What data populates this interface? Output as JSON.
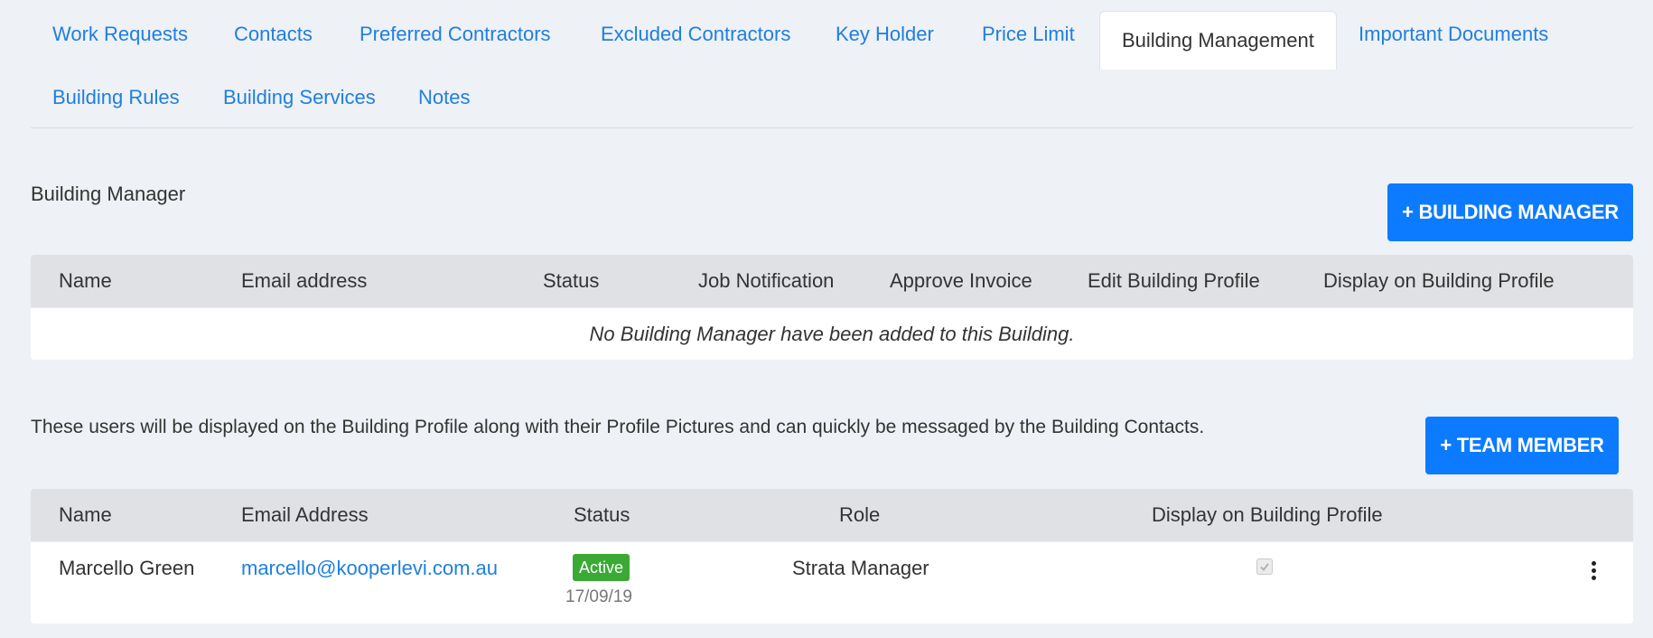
{
  "tabs": [
    {
      "label": "Work Requests"
    },
    {
      "label": "Contacts"
    },
    {
      "label": "Preferred Contractors"
    },
    {
      "label": "Excluded Contractors"
    },
    {
      "label": "Key Holder"
    },
    {
      "label": "Price Limit"
    },
    {
      "label": "Building Management",
      "active": true
    },
    {
      "label": "Important Documents"
    },
    {
      "label": "Building Rules"
    },
    {
      "label": "Building Services"
    },
    {
      "label": "Notes"
    }
  ],
  "building_manager": {
    "section_label": "Building Manager",
    "add_button": "+ BUILDING MANAGER",
    "columns": [
      "Name",
      "Email address",
      "Status",
      "Job Notification",
      "Approve Invoice",
      "Edit Building Profile",
      "Display on Building Profile"
    ],
    "empty_message": "No Building Manager have been added to this Building."
  },
  "team": {
    "info_text": "These users will be displayed on the Building Profile along with their Profile Pictures and can quickly be messaged by the Building Contacts.",
    "add_button": "+ TEAM MEMBER",
    "columns": [
      "Name",
      "Email Address",
      "Status",
      "Role",
      "Display on Building Profile"
    ],
    "rows": [
      {
        "name": "Marcello Green",
        "email": "marcello@kooperlevi.com.au",
        "status": "Active",
        "date": "17/09/19",
        "role": "Strata Manager",
        "display_on_profile": true
      }
    ]
  },
  "colors": {
    "accent": "#0d7bff",
    "link": "#1f7fe0",
    "active_badge": "#3aaa35",
    "header_bg": "#dfe1e5",
    "page_bg": "#eef1f5"
  }
}
